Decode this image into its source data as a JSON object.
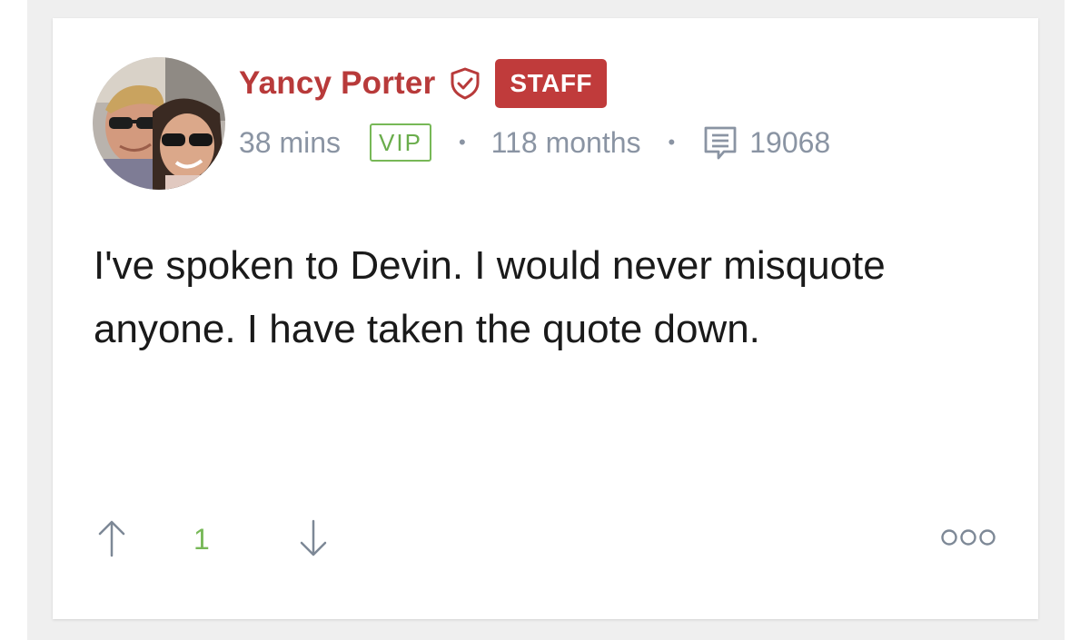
{
  "post": {
    "author": {
      "name": "Yancy Porter",
      "role_badge": "STAFF",
      "avatar_icon": "avatar-photo",
      "verified_icon": "shield-check-icon",
      "name_color": "#b83a3a"
    },
    "meta": {
      "time_ago": "38 mins",
      "membership_badge": "VIP",
      "tenure": "118 months",
      "post_count": "19068",
      "post_count_icon": "comment-icon",
      "separator": "•"
    },
    "body": "I've spoken to Devin. I would never misquote anyone. I have taken the quote down.",
    "actions": {
      "upvote_icon": "arrow-up-icon",
      "vote_count": "1",
      "downvote_icon": "arrow-down-icon",
      "more_icon": "more-options-icon"
    },
    "colors": {
      "staff_badge_bg": "#c03b3b",
      "vip_green": "#77b857",
      "meta_gray": "#8a94a3"
    }
  }
}
